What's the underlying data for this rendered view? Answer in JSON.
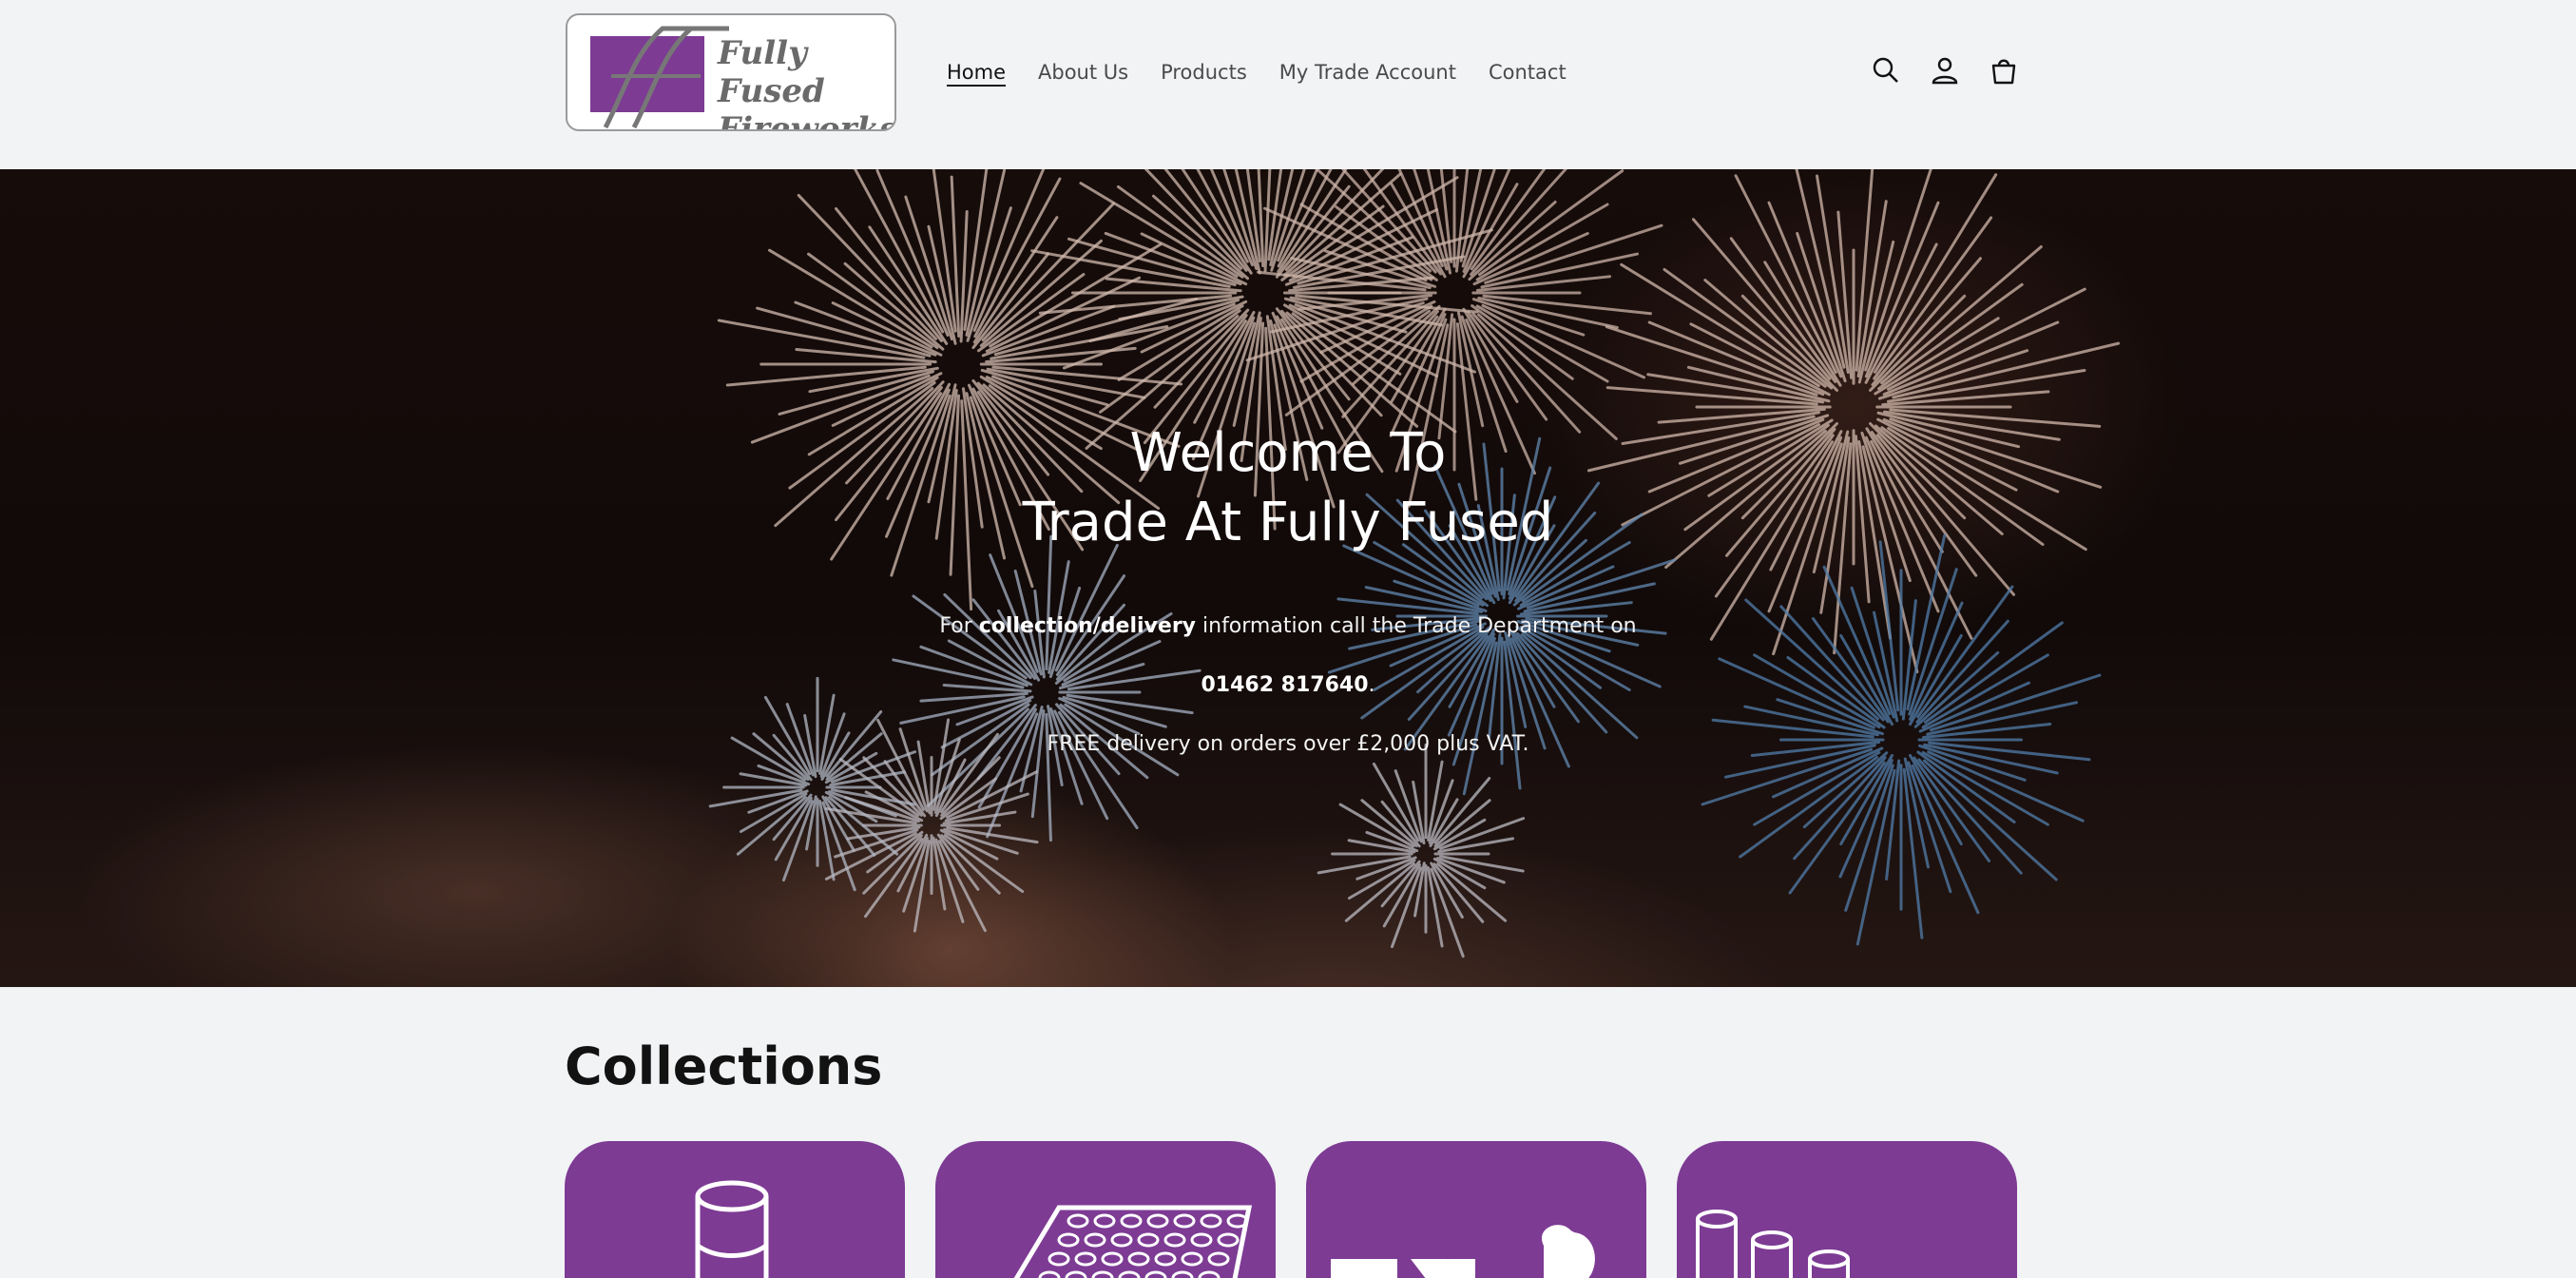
{
  "brand": {
    "name_line1": "Fully Fused",
    "name_line2": "Fireworks",
    "logo_mark": "ff",
    "purple": "#7d3b94"
  },
  "nav": {
    "items": [
      {
        "label": "Home",
        "active": true
      },
      {
        "label": "About Us",
        "active": false
      },
      {
        "label": "Products",
        "active": false
      },
      {
        "label": "My Trade Account",
        "active": false
      },
      {
        "label": "Contact",
        "active": false
      }
    ]
  },
  "header_icons": [
    "search-icon",
    "account-icon",
    "cart-icon"
  ],
  "hero": {
    "title_line1": "Welcome To",
    "title_line2": "Trade At Fully Fused",
    "line1_pre": "For ",
    "line1_bold": "collection/delivery",
    "line1_post": " information call the Trade Department on",
    "phone": "01462 817640",
    "phone_suffix": ".",
    "line3_bold": "FREE",
    "line3_post": " delivery on orders over £2,000 plus VAT."
  },
  "collections": {
    "title": "Collections",
    "cards": [
      {
        "icon": "single-shot-tube-icon"
      },
      {
        "icon": "cake-barrage-icon"
      },
      {
        "icon": "rocket-icon"
      },
      {
        "icon": "roman-candles-icon"
      }
    ]
  }
}
